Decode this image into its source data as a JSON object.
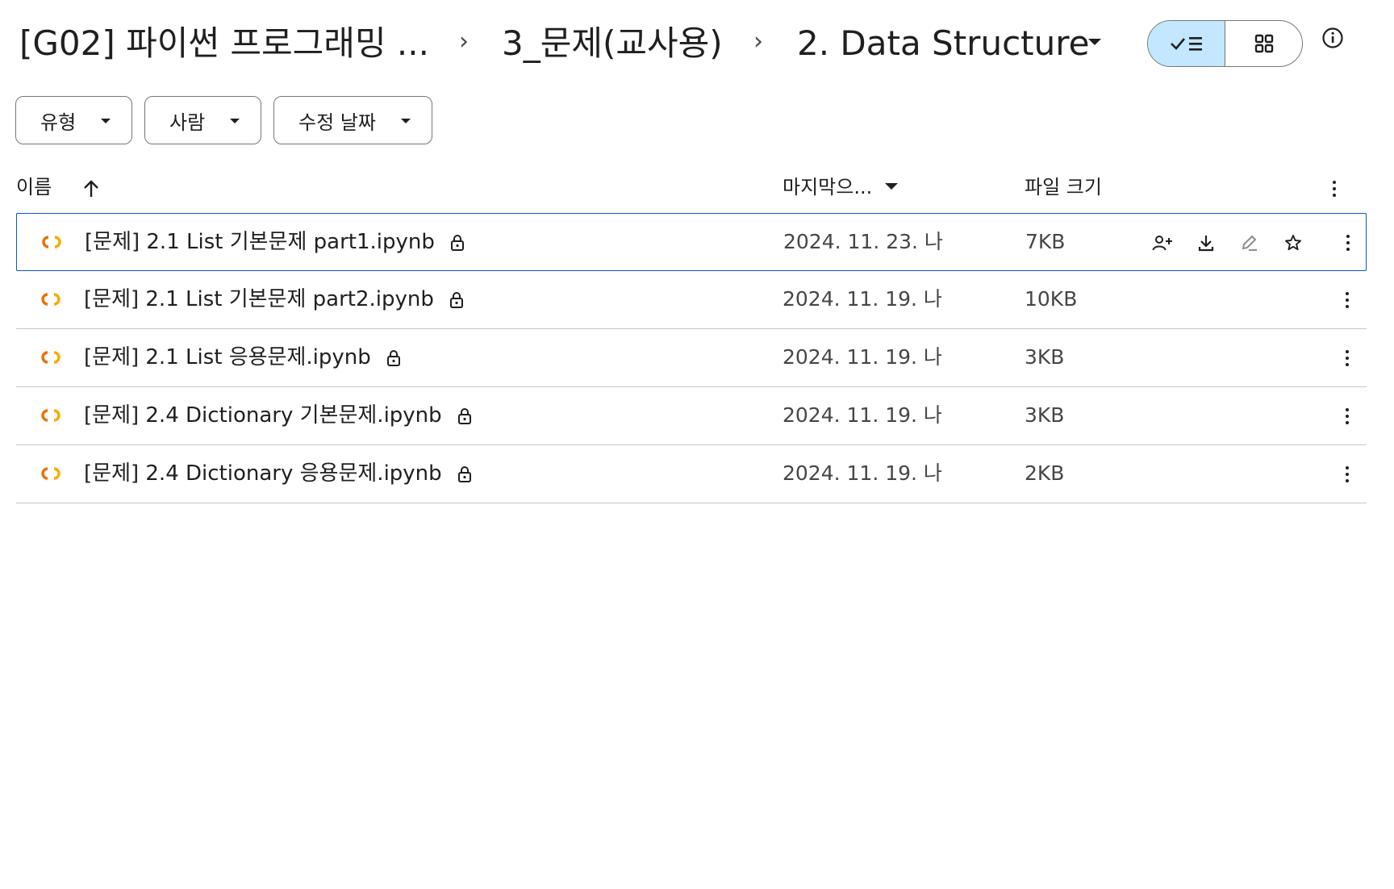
{
  "breadcrumb": {
    "root": "[G02] 파이썬 프로그래밍 ...",
    "middle": "3_문제(교사용)",
    "current": "2. Data Structure",
    "separator": "›"
  },
  "view": {
    "list_icon": "check-list-icon",
    "grid_icon": "grid-icon",
    "info_icon": "info-icon",
    "active": "list"
  },
  "filters": [
    {
      "label": "유형"
    },
    {
      "label": "사람"
    },
    {
      "label": "수정 날짜"
    }
  ],
  "columns": {
    "name": "이름",
    "modified": "마지막으...",
    "size": "파일 크기"
  },
  "files": [
    {
      "name": "[문제] 2.1 List 기본문제 part1.ipynb",
      "date": "2024. 11. 23. 나",
      "size": "7KB",
      "selected": true
    },
    {
      "name": "[문제] 2.1 List 기본문제 part2.ipynb",
      "date": "2024. 11. 19. 나",
      "size": "10KB",
      "selected": false
    },
    {
      "name": "[문제] 2.1 List 응용문제.ipynb",
      "date": "2024. 11. 19. 나",
      "size": "3KB",
      "selected": false
    },
    {
      "name": "[문제] 2.4 Dictionary 기본문제.ipynb",
      "date": "2024. 11. 19. 나",
      "size": "3KB",
      "selected": false
    },
    {
      "name": "[문제] 2.4 Dictionary 응용문제.ipynb",
      "date": "2024. 11. 19. 나",
      "size": "2KB",
      "selected": false
    }
  ],
  "row_actions": [
    "share-icon",
    "download-icon",
    "rename-icon",
    "star-icon"
  ],
  "colors": {
    "accent_selected_bg": "#c2e7ff",
    "selection_border": "#0b57d0",
    "colab_orange": "#e8710a",
    "colab_yellow": "#f9ab00"
  }
}
